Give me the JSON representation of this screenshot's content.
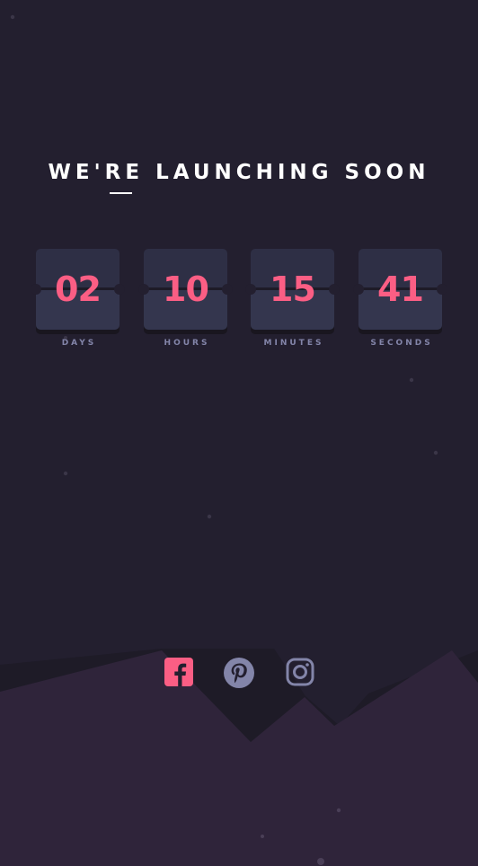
{
  "page": {
    "heading": "WE'RE LAUNCHING SOON"
  },
  "countdown": [
    {
      "value": "02",
      "label": "DAYS"
    },
    {
      "value": "10",
      "label": "HOURS"
    },
    {
      "value": "15",
      "label": "MINUTES"
    },
    {
      "value": "41",
      "label": "SECONDS"
    }
  ],
  "social": [
    {
      "name": "facebook-icon",
      "label": "Facebook"
    },
    {
      "name": "pinterest-icon",
      "label": "Pinterest"
    },
    {
      "name": "instagram-icon",
      "label": "Instagram"
    }
  ],
  "colors": {
    "background": "#231f2f",
    "accent": "#fb5e84",
    "card_top": "#2e2f45",
    "card_bottom": "#34364e",
    "label": "#8385a9",
    "hills_front": "#2f243a",
    "hills_back": "#1e1b27"
  }
}
